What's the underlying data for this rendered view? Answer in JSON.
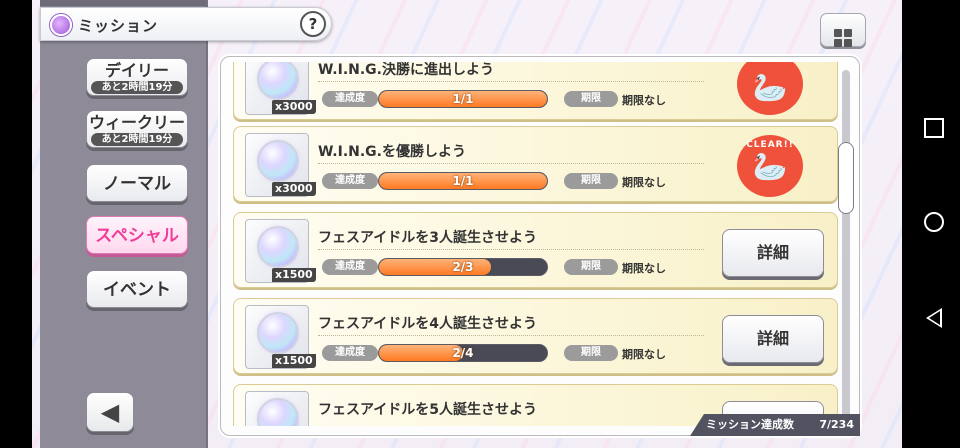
{
  "header": {
    "title": "ミッション",
    "help_label": "?"
  },
  "tabs": [
    {
      "label": "デイリー",
      "sub": "あと2時間19分",
      "active": false
    },
    {
      "label": "ウィークリー",
      "sub": "あと2時間19分",
      "active": false
    },
    {
      "label": "ノーマル",
      "active": false
    },
    {
      "label": "スペシャル",
      "active": true
    },
    {
      "label": "イベント",
      "active": false
    }
  ],
  "back": {
    "label": "◀"
  },
  "missions": [
    {
      "title": "W.I.N.G.決勝に進出しよう",
      "qty": "x3000",
      "progress_label": "達成度",
      "progress_text": "1/1",
      "progress": 1.0,
      "limit_label": "期限",
      "limit_value": "期限なし",
      "status": "cleared"
    },
    {
      "title": "W.I.N.G.を優勝しよう",
      "qty": "x3000",
      "progress_label": "達成度",
      "progress_text": "1/1",
      "progress": 1.0,
      "limit_label": "期限",
      "limit_value": "期限なし",
      "status": "cleared",
      "stamp_text": "CLEAR!!"
    },
    {
      "title": "フェスアイドルを3人誕生させよう",
      "qty": "x1500",
      "progress_label": "達成度",
      "progress_text": "2/3",
      "progress": 0.667,
      "limit_label": "期限",
      "limit_value": "期限なし",
      "status": "detail",
      "detail_label": "詳細"
    },
    {
      "title": "フェスアイドルを4人誕生させよう",
      "qty": "x1500",
      "progress_label": "達成度",
      "progress_text": "2/4",
      "progress": 0.5,
      "limit_label": "期限",
      "limit_value": "期限なし",
      "status": "detail",
      "detail_label": "詳細"
    },
    {
      "title": "フェスアイドルを5人誕生させよう",
      "qty": "",
      "status": "detail"
    }
  ],
  "footer": {
    "label": "ミッション達成数",
    "count": "7/234"
  },
  "colors": {
    "accent": "#ee3e9a",
    "progress": "#ff7a22",
    "stamp": "#f0513a"
  }
}
